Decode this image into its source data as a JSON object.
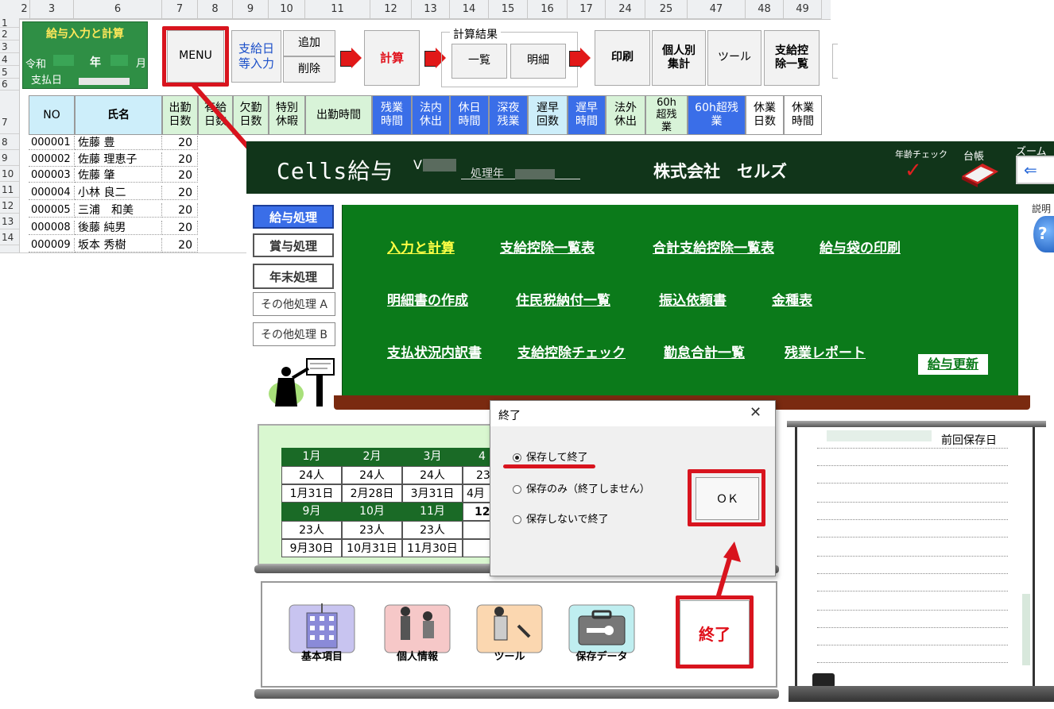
{
  "sheet": {
    "col_headers": [
      "2",
      "3",
      "6",
      "7",
      "8",
      "9",
      "10",
      "11",
      "12",
      "13",
      "14",
      "15",
      "16",
      "17",
      "24",
      "25",
      "47",
      "48",
      "49"
    ],
    "row_headers": [
      "1",
      "2",
      "3",
      "4",
      "5",
      "6",
      "7",
      "8",
      "9",
      "10",
      "11",
      "12",
      "13",
      "14"
    ],
    "green_panel": {
      "title": "給与入力と計算",
      "era": "令和",
      "year_label": "年",
      "month_label": "月",
      "payday_label": "支払日"
    },
    "buttons": {
      "menu": "MENU",
      "payday_input": "支給日\n等入力",
      "add": "追加",
      "delete": "削除",
      "calc": "計算",
      "results_group": "計算結果",
      "list": "一覧",
      "detail": "明細",
      "print": "印刷",
      "by_person": "個人別\n集計",
      "tool": "ツール",
      "deduction_list": "支給控\n除一覧"
    },
    "table_headers": [
      "NO",
      "氏名",
      "出勤\n日数",
      "有給\n日数",
      "欠勤\n日数",
      "特別\n休暇",
      "出勤時間",
      "残業\n時間",
      "法内\n休出",
      "休日\n時間",
      "深夜\n残業",
      "遅早\n回数",
      "遅早\n時間",
      "法外\n休出",
      "60h\n超残\n業",
      "60h超残\n業",
      "休業\n日数",
      "休業\n時間"
    ],
    "rows": [
      {
        "no": "000001",
        "name": "佐藤 豊",
        "days": "20"
      },
      {
        "no": "000002",
        "name": "佐藤 理恵子",
        "days": "20"
      },
      {
        "no": "000003",
        "name": "佐藤 肇",
        "days": "20"
      },
      {
        "no": "000004",
        "name": "小林 良二",
        "days": "20"
      },
      {
        "no": "000005",
        "name": "三浦　和美",
        "days": "20"
      },
      {
        "no": "000008",
        "name": "後藤 純男",
        "days": "20"
      },
      {
        "no": "000009",
        "name": "坂本 秀樹",
        "days": "20"
      }
    ]
  },
  "app": {
    "title": "Cells給与",
    "version_prefix": "V",
    "year_label": "処理年",
    "company": "株式会社　セルズ",
    "age_check": "年齢チェック",
    "ledger": "台帳",
    "zoom": "ズーム",
    "help_label": "説明",
    "side_buttons": [
      "給与処理",
      "賞与処理",
      "年末処理",
      "その他処理 A",
      "その他処理 B"
    ],
    "menu_links": [
      [
        "入力と計算",
        "支給控除一覧表",
        "合計支給控除一覧表",
        "給与袋の印刷"
      ],
      [
        "明細書の作成",
        "住民税納付一覧",
        "振込依頼書",
        "金種表"
      ],
      [
        "支払状況内訳書",
        "支給控除チェック",
        "勤怠合計一覧",
        "残業レポート"
      ]
    ],
    "update_button": "給与更新",
    "calendar": {
      "months_row1": [
        "1月",
        "2月",
        "3月",
        "4"
      ],
      "counts_row1": [
        "24人",
        "24人",
        "24人",
        "23"
      ],
      "dates_row1": [
        "1月31日",
        "2月28日",
        "3月31日",
        "4月"
      ],
      "months_row2": [
        "9月",
        "10月",
        "11月",
        "12"
      ],
      "counts_row2": [
        "23人",
        "23人",
        "23人"
      ],
      "dates_row2": [
        "9月30日",
        "10月31日",
        "11月30日"
      ]
    },
    "bottom_icons": [
      "基本項目",
      "個人情報",
      "ツール",
      "保存データ"
    ],
    "exit_button": "終了",
    "last_saved": "前回保存日"
  },
  "dialog": {
    "title": "終了",
    "close": "✕",
    "options": [
      "保存して終了",
      "保存のみ（終了しません）",
      "保存しないで終了"
    ],
    "selected": 0,
    "ok": "ＯＫ"
  },
  "colors": {
    "accent_red": "#d8141e",
    "dark_green": "#11351a",
    "menu_green": "#0b7a1a",
    "blue_header": "#3a6ee8"
  }
}
